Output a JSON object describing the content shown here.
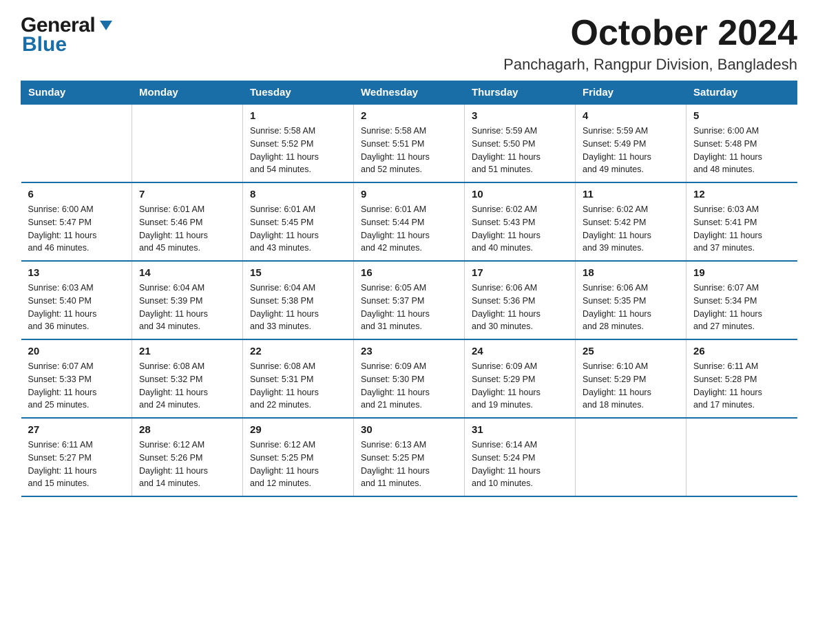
{
  "logo": {
    "general": "General",
    "blue": "Blue"
  },
  "header": {
    "month": "October 2024",
    "location": "Panchagarh, Rangpur Division, Bangladesh"
  },
  "weekdays": [
    "Sunday",
    "Monday",
    "Tuesday",
    "Wednesday",
    "Thursday",
    "Friday",
    "Saturday"
  ],
  "weeks": [
    [
      {
        "day": "",
        "info": ""
      },
      {
        "day": "",
        "info": ""
      },
      {
        "day": "1",
        "info": "Sunrise: 5:58 AM\nSunset: 5:52 PM\nDaylight: 11 hours\nand 54 minutes."
      },
      {
        "day": "2",
        "info": "Sunrise: 5:58 AM\nSunset: 5:51 PM\nDaylight: 11 hours\nand 52 minutes."
      },
      {
        "day": "3",
        "info": "Sunrise: 5:59 AM\nSunset: 5:50 PM\nDaylight: 11 hours\nand 51 minutes."
      },
      {
        "day": "4",
        "info": "Sunrise: 5:59 AM\nSunset: 5:49 PM\nDaylight: 11 hours\nand 49 minutes."
      },
      {
        "day": "5",
        "info": "Sunrise: 6:00 AM\nSunset: 5:48 PM\nDaylight: 11 hours\nand 48 minutes."
      }
    ],
    [
      {
        "day": "6",
        "info": "Sunrise: 6:00 AM\nSunset: 5:47 PM\nDaylight: 11 hours\nand 46 minutes."
      },
      {
        "day": "7",
        "info": "Sunrise: 6:01 AM\nSunset: 5:46 PM\nDaylight: 11 hours\nand 45 minutes."
      },
      {
        "day": "8",
        "info": "Sunrise: 6:01 AM\nSunset: 5:45 PM\nDaylight: 11 hours\nand 43 minutes."
      },
      {
        "day": "9",
        "info": "Sunrise: 6:01 AM\nSunset: 5:44 PM\nDaylight: 11 hours\nand 42 minutes."
      },
      {
        "day": "10",
        "info": "Sunrise: 6:02 AM\nSunset: 5:43 PM\nDaylight: 11 hours\nand 40 minutes."
      },
      {
        "day": "11",
        "info": "Sunrise: 6:02 AM\nSunset: 5:42 PM\nDaylight: 11 hours\nand 39 minutes."
      },
      {
        "day": "12",
        "info": "Sunrise: 6:03 AM\nSunset: 5:41 PM\nDaylight: 11 hours\nand 37 minutes."
      }
    ],
    [
      {
        "day": "13",
        "info": "Sunrise: 6:03 AM\nSunset: 5:40 PM\nDaylight: 11 hours\nand 36 minutes."
      },
      {
        "day": "14",
        "info": "Sunrise: 6:04 AM\nSunset: 5:39 PM\nDaylight: 11 hours\nand 34 minutes."
      },
      {
        "day": "15",
        "info": "Sunrise: 6:04 AM\nSunset: 5:38 PM\nDaylight: 11 hours\nand 33 minutes."
      },
      {
        "day": "16",
        "info": "Sunrise: 6:05 AM\nSunset: 5:37 PM\nDaylight: 11 hours\nand 31 minutes."
      },
      {
        "day": "17",
        "info": "Sunrise: 6:06 AM\nSunset: 5:36 PM\nDaylight: 11 hours\nand 30 minutes."
      },
      {
        "day": "18",
        "info": "Sunrise: 6:06 AM\nSunset: 5:35 PM\nDaylight: 11 hours\nand 28 minutes."
      },
      {
        "day": "19",
        "info": "Sunrise: 6:07 AM\nSunset: 5:34 PM\nDaylight: 11 hours\nand 27 minutes."
      }
    ],
    [
      {
        "day": "20",
        "info": "Sunrise: 6:07 AM\nSunset: 5:33 PM\nDaylight: 11 hours\nand 25 minutes."
      },
      {
        "day": "21",
        "info": "Sunrise: 6:08 AM\nSunset: 5:32 PM\nDaylight: 11 hours\nand 24 minutes."
      },
      {
        "day": "22",
        "info": "Sunrise: 6:08 AM\nSunset: 5:31 PM\nDaylight: 11 hours\nand 22 minutes."
      },
      {
        "day": "23",
        "info": "Sunrise: 6:09 AM\nSunset: 5:30 PM\nDaylight: 11 hours\nand 21 minutes."
      },
      {
        "day": "24",
        "info": "Sunrise: 6:09 AM\nSunset: 5:29 PM\nDaylight: 11 hours\nand 19 minutes."
      },
      {
        "day": "25",
        "info": "Sunrise: 6:10 AM\nSunset: 5:29 PM\nDaylight: 11 hours\nand 18 minutes."
      },
      {
        "day": "26",
        "info": "Sunrise: 6:11 AM\nSunset: 5:28 PM\nDaylight: 11 hours\nand 17 minutes."
      }
    ],
    [
      {
        "day": "27",
        "info": "Sunrise: 6:11 AM\nSunset: 5:27 PM\nDaylight: 11 hours\nand 15 minutes."
      },
      {
        "day": "28",
        "info": "Sunrise: 6:12 AM\nSunset: 5:26 PM\nDaylight: 11 hours\nand 14 minutes."
      },
      {
        "day": "29",
        "info": "Sunrise: 6:12 AM\nSunset: 5:25 PM\nDaylight: 11 hours\nand 12 minutes."
      },
      {
        "day": "30",
        "info": "Sunrise: 6:13 AM\nSunset: 5:25 PM\nDaylight: 11 hours\nand 11 minutes."
      },
      {
        "day": "31",
        "info": "Sunrise: 6:14 AM\nSunset: 5:24 PM\nDaylight: 11 hours\nand 10 minutes."
      },
      {
        "day": "",
        "info": ""
      },
      {
        "day": "",
        "info": ""
      }
    ]
  ]
}
